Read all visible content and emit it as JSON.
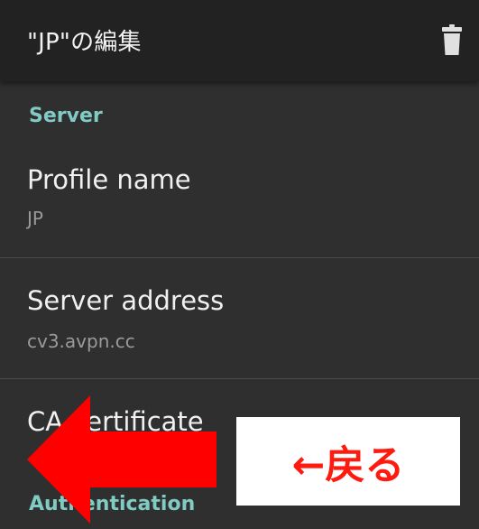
{
  "appbar": {
    "title": "\"JP\"の編集",
    "delete_icon": "trash-icon"
  },
  "sections": {
    "server_header": "Server",
    "auth_header": "Authentication"
  },
  "prefs": {
    "profile_name": {
      "title": "Profile name",
      "summary": "JP"
    },
    "server_address": {
      "title": "Server address",
      "summary": "cv3.avpn.cc"
    },
    "ca_certificate": {
      "title": "CA certificate"
    }
  },
  "annotation": {
    "back_label": "←戻る",
    "arrow_color": "#ff0000",
    "arrow_icon": "arrow-left-icon"
  },
  "colors": {
    "accent": "#80cbc4",
    "background": "#2f2f2f",
    "appbar": "#222222"
  }
}
